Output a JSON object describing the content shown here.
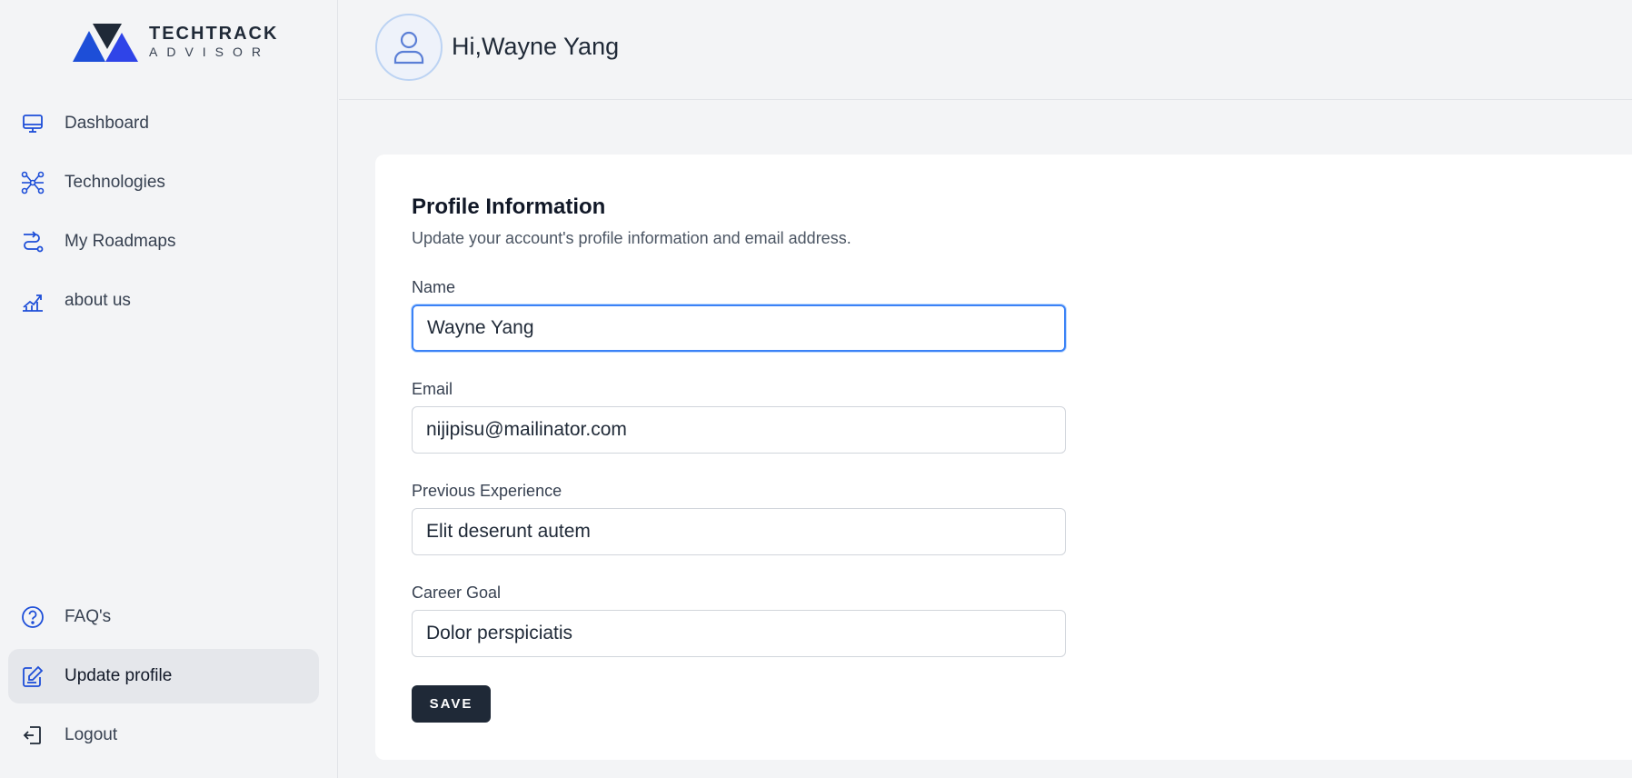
{
  "brand": {
    "name": "TECHTRACK",
    "tagline": "ADVISOR",
    "colors": {
      "primary": "#1d4ed8",
      "dark": "#1f2937"
    }
  },
  "sidebar": {
    "top_items": [
      {
        "label": "Dashboard",
        "icon": "monitor-icon"
      },
      {
        "label": "Technologies",
        "icon": "network-icon"
      },
      {
        "label": "My Roadmaps",
        "icon": "route-icon"
      },
      {
        "label": "about us",
        "icon": "chart-icon"
      }
    ],
    "bottom_items": [
      {
        "label": "FAQ's",
        "icon": "question-circle-icon"
      },
      {
        "label": "Update profile",
        "icon": "edit-icon",
        "active": true
      },
      {
        "label": "Logout",
        "icon": "logout-icon"
      }
    ]
  },
  "header": {
    "greeting": "Hi,Wayne Yang",
    "avatar_icon": "user-icon"
  },
  "profile": {
    "title": "Profile Information",
    "subtitle": "Update your account's profile information and email address.",
    "fields": {
      "name": {
        "label": "Name",
        "value": "Wayne Yang"
      },
      "email": {
        "label": "Email",
        "value": "nijipisu@mailinator.com"
      },
      "experience": {
        "label": "Previous Experience",
        "value": "Elit deserunt autem"
      },
      "goal": {
        "label": "Career Goal",
        "value": "Dolor perspiciatis"
      }
    },
    "save_label": "SAVE"
  }
}
